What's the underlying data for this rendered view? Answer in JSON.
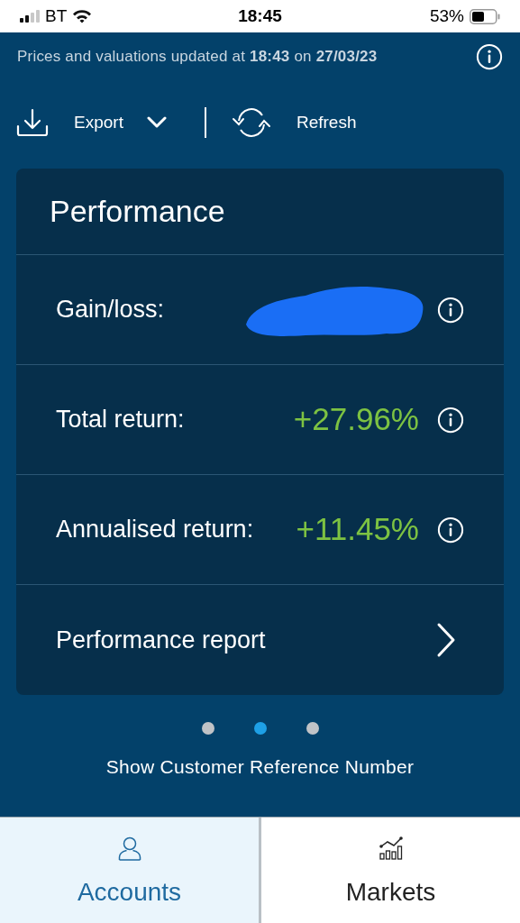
{
  "status_bar": {
    "carrier": "BT",
    "time": "18:45",
    "battery": "53%"
  },
  "update_notice": "Prices and valuations updated at **18:43** on **27/03/23**",
  "toolbar": {
    "export": "Export",
    "refresh": "Refresh"
  },
  "card": {
    "title": "Performance",
    "rows": [
      {
        "kind": "redacted",
        "label": "Gain/loss:",
        "info": true
      },
      {
        "kind": "value",
        "label": "Total return:",
        "value": "+27.96%",
        "info": true
      },
      {
        "kind": "value",
        "label": "Annualised return:",
        "value": "+11.45%",
        "info": true
      },
      {
        "kind": "link",
        "label": "Performance report"
      }
    ]
  },
  "pager": [
    {
      "selected": false
    },
    {
      "selected": true
    },
    {
      "selected": false
    }
  ],
  "reference_link": "Show Customer Reference Number",
  "tabs": [
    {
      "kind": "person",
      "label": "Accounts",
      "selected": true
    },
    {
      "kind": "chart",
      "label": "Markets",
      "selected": false
    }
  ]
}
